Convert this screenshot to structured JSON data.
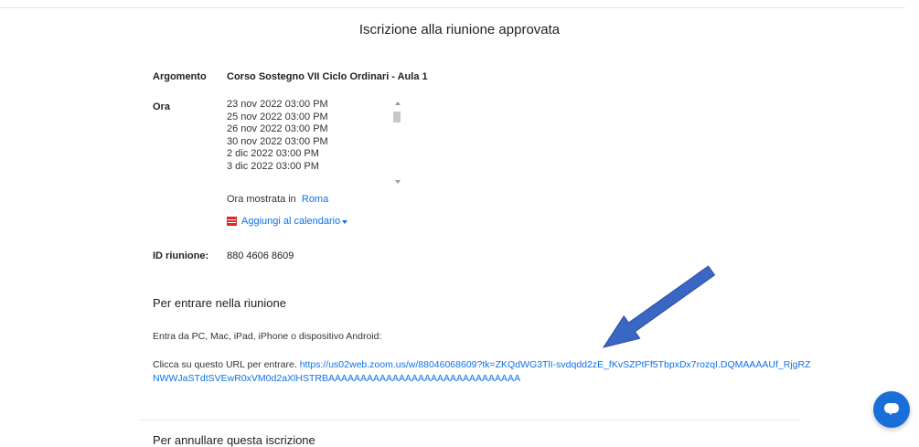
{
  "page": {
    "title": "Iscrizione alla riunione approvata"
  },
  "meeting": {
    "topic_label": "Argomento",
    "topic_value": "Corso Sostegno VII Ciclo Ordinari - Aula 1",
    "time_label": "Ora",
    "times": [
      "23 nov 2022 03:00 PM",
      "25 nov 2022 03:00 PM",
      "26 nov 2022 03:00 PM",
      "30 nov 2022 03:00 PM",
      "2 dic 2022 03:00 PM",
      "3 dic 2022 03:00 PM"
    ],
    "timezone_prefix": "Ora mostrata in",
    "timezone_link": "Roma",
    "calendar_link": "Aggiungi al calendario",
    "id_label": "ID riunione:",
    "id_value": "880 4606 8609"
  },
  "join": {
    "heading": "Per entrare nella riunione",
    "devices_text": "Entra da PC, Mac, iPad, iPhone o dispositivo Android:",
    "url_prefix": "Clicca su questo URL per entrare.",
    "url": "https://us02web.zoom.us/w/88046068609?tk=ZKQdWG3TlI-svdqdd2zE_fKvSZPtFf5TbpxDx7rozqI.DQMAAAAUf_RjgRZNWWJaSTdtSVEwR0xVM0d2aXlHSTRBAAAAAAAAAAAAAAAAAAAAAAAAAAAAAA"
  },
  "cancel": {
    "heading": "Per annullare questa iscrizione"
  },
  "colors": {
    "link": "#0e71eb",
    "arrow": "#3a66c4",
    "chat_button": "#1a6ed8",
    "calendar_icon": "#e02828"
  },
  "icons": {
    "calendar": "calendar-icon",
    "chat": "chat-bubble-icon",
    "dropdown": "caret-down-icon"
  }
}
